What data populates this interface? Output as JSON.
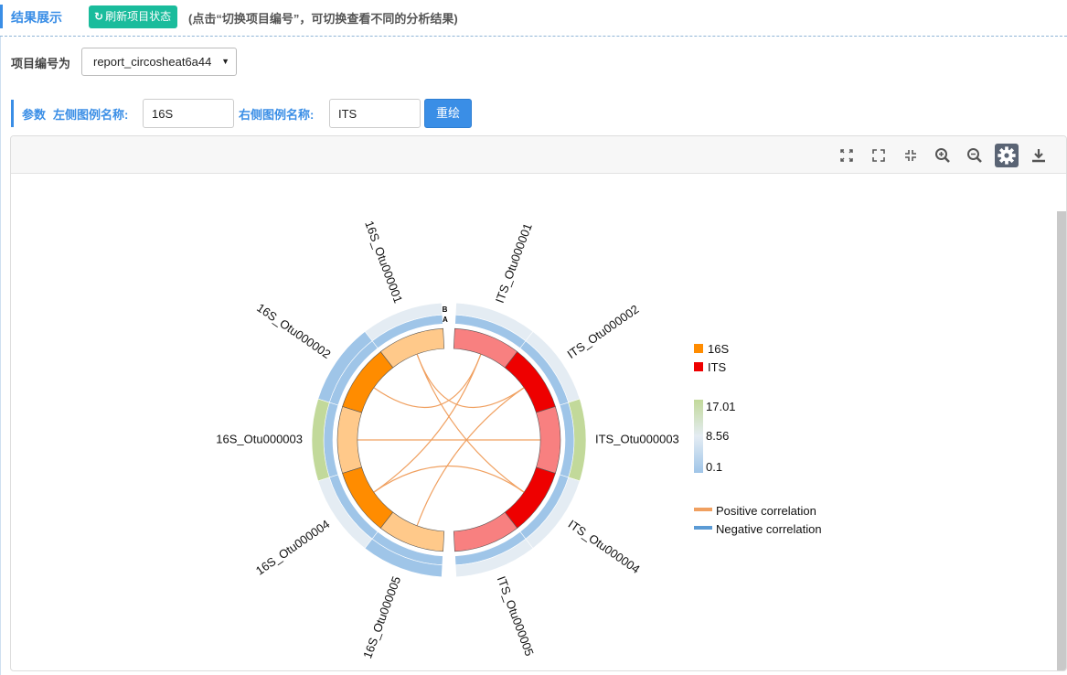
{
  "header": {
    "section_title": "结果展示",
    "refresh_icon": "↻",
    "refresh_label": "刷新项目状态",
    "hint": "(点击“切换项目编号”，可切换查看不同的分析结果)"
  },
  "project": {
    "label": "项目编号为",
    "selected": "report_circosheat6a44"
  },
  "params": {
    "title": "参数",
    "left_legend_label": "左侧图例名称:",
    "left_legend_value": "16S",
    "right_legend_label": "右侧图例名称:",
    "right_legend_value": "ITS",
    "redraw_label": "重绘"
  },
  "toolbar": {
    "icons": [
      "expand-icon",
      "fullscreen-icon",
      "compress-icon",
      "zoom-in-icon",
      "zoom-out-icon",
      "settings-icon",
      "download-icon"
    ]
  },
  "chart_data": {
    "type": "chord",
    "track_labels": [
      "B",
      "A"
    ],
    "groups": [
      {
        "name": "16S",
        "color": "#ff8c00",
        "items": [
          {
            "name": "16S_Otu000001",
            "value": 0.1,
            "color": "#ffc98a"
          },
          {
            "name": "16S_Otu000002",
            "value": 17.01,
            "color": "#ff8c00"
          },
          {
            "name": "16S_Otu000003",
            "value": 8.56,
            "color": "#ffc98a"
          },
          {
            "name": "16S_Otu000004",
            "value": 17.01,
            "color": "#ff8c00"
          },
          {
            "name": "16S_Otu000005",
            "value": 0.1,
            "color": "#ffc98a"
          }
        ]
      },
      {
        "name": "ITS",
        "color": "#ee0000",
        "items": [
          {
            "name": "ITS_Otu000001",
            "value": 0.1,
            "color": "#f88080"
          },
          {
            "name": "ITS_Otu000002",
            "value": 17.01,
            "color": "#ee0000"
          },
          {
            "name": "ITS_Otu000003",
            "value": 8.56,
            "color": "#f88080"
          },
          {
            "name": "ITS_Otu000004",
            "value": 17.01,
            "color": "#ee0000"
          },
          {
            "name": "ITS_Otu000005",
            "value": 0.1,
            "color": "#f88080"
          }
        ]
      }
    ],
    "heat_track_A": [
      {
        "item": "16S_Otu000001",
        "value": 0.1
      },
      {
        "item": "16S_Otu000002",
        "value": 0.1
      },
      {
        "item": "16S_Otu000003",
        "value": 0.1
      },
      {
        "item": "16S_Otu000004",
        "value": 0.1
      },
      {
        "item": "16S_Otu000005",
        "value": 0.1
      },
      {
        "item": "ITS_Otu000001",
        "value": 0.1
      },
      {
        "item": "ITS_Otu000002",
        "value": 0.1
      },
      {
        "item": "ITS_Otu000003",
        "value": 0.1
      },
      {
        "item": "ITS_Otu000004",
        "value": 0.1
      },
      {
        "item": "ITS_Otu000005",
        "value": 0.1
      }
    ],
    "heat_track_B": [
      {
        "item": "16S_Otu000001",
        "value": 8.56
      },
      {
        "item": "16S_Otu000002",
        "value": 0.1
      },
      {
        "item": "16S_Otu000003",
        "value": 17.01
      },
      {
        "item": "16S_Otu000004",
        "value": 8.56
      },
      {
        "item": "16S_Otu000005",
        "value": 0.1
      },
      {
        "item": "ITS_Otu000001",
        "value": 8.56
      },
      {
        "item": "ITS_Otu000002",
        "value": 8.56
      },
      {
        "item": "ITS_Otu000003",
        "value": 17.01
      },
      {
        "item": "ITS_Otu000004",
        "value": 8.56
      },
      {
        "item": "ITS_Otu000005",
        "value": 8.56
      }
    ],
    "links": [
      {
        "source": "16S_Otu000005",
        "target": "ITS_Otu000002",
        "type": "positive"
      },
      {
        "source": "16S_Otu000001",
        "target": "ITS_Otu000002",
        "type": "positive"
      },
      {
        "source": "16S_Otu000004",
        "target": "ITS_Otu000001",
        "type": "positive"
      },
      {
        "source": "16S_Otu000003",
        "target": "ITS_Otu000003",
        "type": "positive"
      },
      {
        "source": "16S_Otu000002",
        "target": "ITS_Otu000001",
        "type": "positive"
      },
      {
        "source": "16S_Otu000004",
        "target": "ITS_Otu000004",
        "type": "positive"
      },
      {
        "source": "16S_Otu000001",
        "target": "ITS_Otu000004",
        "type": "positive"
      }
    ],
    "heat_legend": {
      "max": "17.01",
      "mid": "8.56",
      "min": "0.1",
      "colors": [
        "#9fc5e8",
        "#e4ecf3",
        "#c2d99a"
      ]
    },
    "link_legend": [
      {
        "label": "Positive correlation",
        "color": "#f0a060"
      },
      {
        "label": "Negative correlation",
        "color": "#5b9bd5"
      }
    ]
  }
}
